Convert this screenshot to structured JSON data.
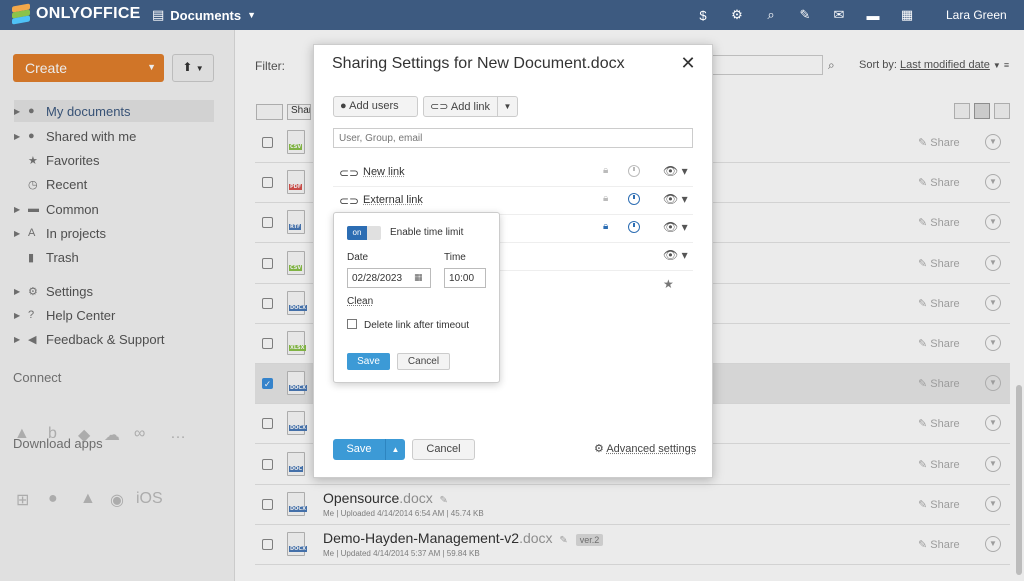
{
  "header": {
    "app_name": "ONLYOFFICE",
    "module": "Documents",
    "user_name": "Lara Green",
    "icons": [
      "paid-icon",
      "settings-icon",
      "search-icon",
      "feed-icon",
      "mail-icon",
      "chat-icon",
      "calendar-icon"
    ]
  },
  "sidebar": {
    "create_label": "Create",
    "items": [
      {
        "label": "My documents"
      },
      {
        "label": "Shared with me"
      },
      {
        "label": "Favorites"
      },
      {
        "label": "Recent"
      },
      {
        "label": "Common"
      },
      {
        "label": "In projects"
      },
      {
        "label": "Trash"
      },
      {
        "label": "Settings"
      },
      {
        "label": "Help Center"
      },
      {
        "label": "Feedback & Support"
      }
    ],
    "connect_label": "Connect",
    "download_label": "Download apps",
    "ios_label": "iOS"
  },
  "toolbar": {
    "filter_label": "Filter:",
    "sort_label": "Sort by:",
    "sort_value": "Last modified date",
    "share_tool": "Share"
  },
  "files": [
    {
      "type": "CSV",
      "color": "#8bc34a"
    },
    {
      "type": "PDF",
      "color": "#d9534f"
    },
    {
      "type": "RTF",
      "color": "#4a7ab8"
    },
    {
      "type": "CSV",
      "color": "#8bc34a"
    },
    {
      "type": "DOCX",
      "color": "#4a7ab8"
    },
    {
      "type": "XLSX",
      "color": "#8bc34a"
    },
    {
      "type": "DOCX",
      "color": "#4a7ab8"
    },
    {
      "type": "DOCX",
      "color": "#4a7ab8"
    },
    {
      "type": "DOC",
      "color": "#4a7ab8"
    },
    {
      "type": "DOCX",
      "color": "#4a7ab8",
      "name": "Opensource",
      "ext": ".docx",
      "meta": "Me | Uploaded 4/14/2014 6:54 AM | 45.74 KB"
    },
    {
      "type": "DOCX",
      "color": "#4a7ab8",
      "name": "Demo-Hayden-Management-v2",
      "ext": ".docx",
      "version": "ver.2",
      "meta": "Me | Updated 4/14/2014 5:37 AM | 59.84 KB"
    }
  ],
  "share_label": "Share",
  "dialog": {
    "title": "Sharing Settings for New Document.docx",
    "add_users_label": "Add users",
    "add_link_label": "Add link",
    "search_placeholder": "User, Group, email",
    "links": [
      {
        "name": "New link"
      },
      {
        "name": "External link"
      }
    ],
    "save_label": "Save",
    "cancel_label": "Cancel",
    "advanced_label": "Advanced settings"
  },
  "popover": {
    "toggle_state": "on",
    "toggle_label": "Enable time limit",
    "date_label": "Date",
    "time_label": "Time",
    "date_value": "02/28/2023",
    "time_value": "10:00",
    "clean_label": "Clean",
    "delete_label": "Delete link after timeout",
    "save_label": "Save",
    "cancel_label": "Cancel"
  }
}
